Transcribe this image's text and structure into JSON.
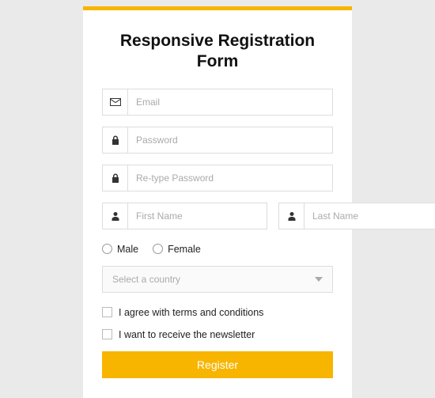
{
  "title": "Responsive Registration Form",
  "fields": {
    "email": {
      "placeholder": "Email"
    },
    "password": {
      "placeholder": "Password"
    },
    "password2": {
      "placeholder": "Re-type Password"
    },
    "first_name": {
      "placeholder": "First Name"
    },
    "last_name": {
      "placeholder": "Last Name"
    }
  },
  "gender": {
    "male": "Male",
    "female": "Female"
  },
  "country": {
    "placeholder": "Select a country"
  },
  "terms": {
    "label": "I agree with terms and conditions"
  },
  "newsletter": {
    "label": "I want to receive the newsletter"
  },
  "submit": {
    "label": "Register"
  },
  "colors": {
    "accent": "#f7b500"
  }
}
